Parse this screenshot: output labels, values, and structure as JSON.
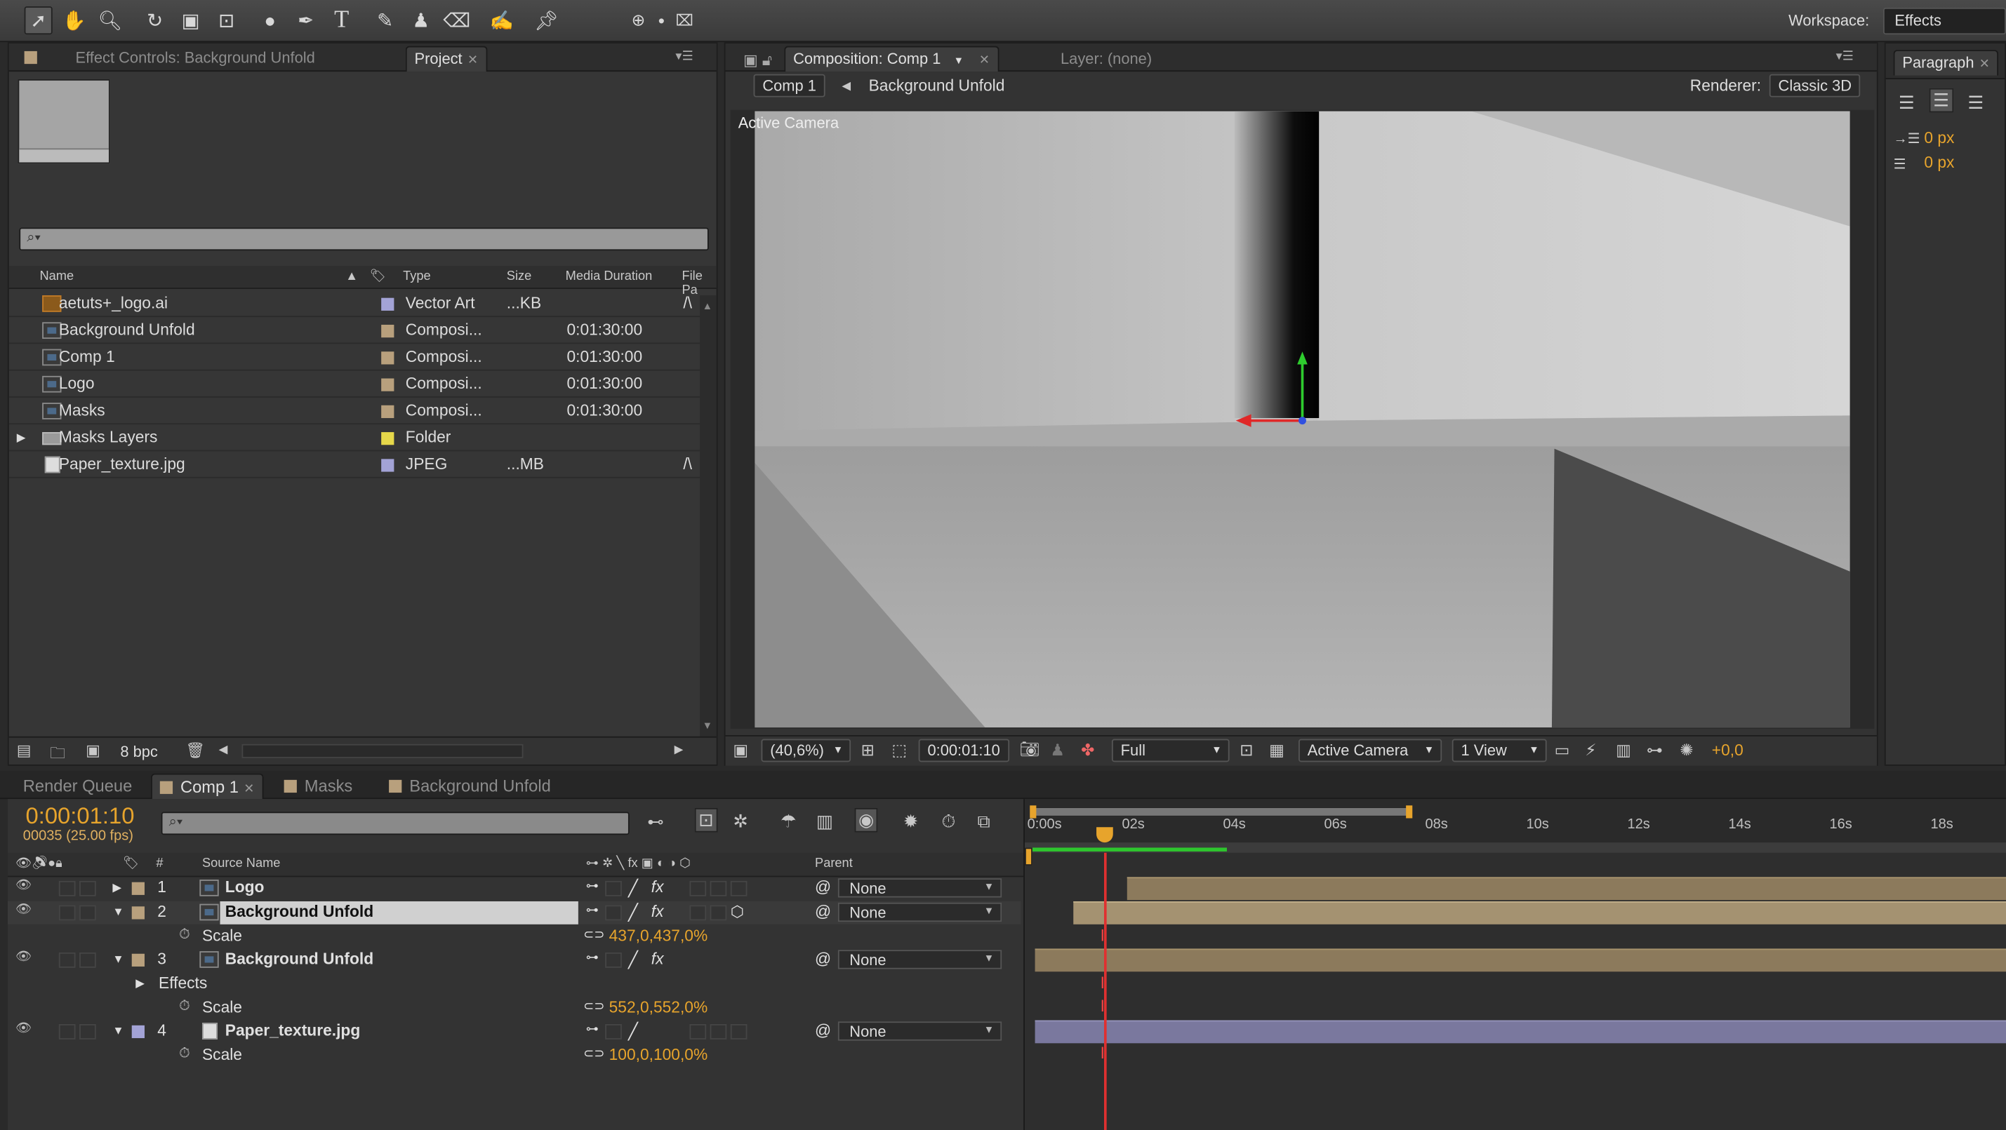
{
  "workspace": {
    "label": "Workspace:",
    "value": "Effects"
  },
  "tools": [
    "selection-tool",
    "hand-tool",
    "zoom-tool",
    "rotation-tool",
    "camera-tool",
    "pan-behind-tool",
    "shape-tool",
    "pen-tool",
    "type-tool",
    "brush-tool",
    "clone-stamp-tool",
    "eraser-tool",
    "roto-brush-tool",
    "puppet-pin-tool"
  ],
  "left_panel": {
    "tabs": [
      {
        "label": "Effect Controls: Background Unfold"
      },
      {
        "label": "Project"
      }
    ],
    "search_placeholder": "",
    "columns": [
      "Name",
      "Type",
      "Size",
      "Media Duration",
      "File Pa"
    ],
    "items": [
      {
        "name": "aetuts+_logo.ai",
        "icon": "illustrator-file-icon",
        "label_color": "#a3a3d6",
        "type": "Vector Art",
        "size": "...KB",
        "duration": "",
        "path": "/\\"
      },
      {
        "name": "Background Unfold",
        "icon": "composition-icon",
        "label_color": "#b8a07d",
        "type": "Composi...",
        "size": "",
        "duration": "0:01:30:00",
        "path": ""
      },
      {
        "name": "Comp 1",
        "icon": "composition-icon",
        "label_color": "#b8a07d",
        "type": "Composi...",
        "size": "",
        "duration": "0:01:30:00",
        "path": ""
      },
      {
        "name": "Logo",
        "icon": "composition-icon",
        "label_color": "#b8a07d",
        "type": "Composi...",
        "size": "",
        "duration": "0:01:30:00",
        "path": ""
      },
      {
        "name": "Masks",
        "icon": "composition-icon",
        "label_color": "#b8a07d",
        "type": "Composi...",
        "size": "",
        "duration": "0:01:30:00",
        "path": ""
      },
      {
        "name": "Masks Layers",
        "icon": "folder-icon",
        "label_color": "#e6d84a",
        "type": "Folder",
        "size": "",
        "duration": "",
        "path": ""
      },
      {
        "name": "Paper_texture.jpg",
        "icon": "image-file-icon",
        "label_color": "#a3a3d6",
        "type": "JPEG",
        "size": "...MB",
        "duration": "",
        "path": "/\\"
      }
    ],
    "bpc": "8 bpc"
  },
  "comp_panel": {
    "tabs": [
      {
        "label": "Composition: Comp 1"
      },
      {
        "label": "Layer: (none)"
      }
    ],
    "breadcrumb": {
      "current": "Comp 1",
      "parent": "Background Unfold"
    },
    "renderer_label": "Renderer:",
    "renderer_value": "Classic 3D",
    "view_label": "Active Camera",
    "footer": {
      "zoom": "(40,6%)",
      "timecode": "0:00:01:10",
      "resolution": "Full",
      "camera": "Active Camera",
      "views": "1 View",
      "exposure": "+0,0"
    }
  },
  "paragraph_panel": {
    "tab": "Paragraph",
    "indent1": "0 px",
    "indent2": "0 px"
  },
  "timeline": {
    "tabs": [
      {
        "label": "Render Queue"
      },
      {
        "label": "Comp 1"
      },
      {
        "label": "Masks"
      },
      {
        "label": "Background Unfold"
      }
    ],
    "timecode": "0:00:01:10",
    "frames": "00035 (25.00 fps)",
    "col_source": "Source Name",
    "col_parent": "Parent",
    "col_num": "#",
    "ruler": [
      "0:00s",
      "02s",
      "04s",
      "06s",
      "08s",
      "10s",
      "12s",
      "14s",
      "16s",
      "18s"
    ],
    "rows": [
      {
        "kind": "layer",
        "num": "1",
        "name": "Logo",
        "label_color": "#b8a07d",
        "parent": "None",
        "expanded": false,
        "selected": false
      },
      {
        "kind": "layer",
        "num": "2",
        "name": "Background Unfold",
        "label_color": "#b8a07d",
        "parent": "None",
        "expanded": true,
        "selected": true
      },
      {
        "kind": "prop",
        "name": "Scale",
        "value": "437,0,437,0%"
      },
      {
        "kind": "layer",
        "num": "3",
        "name": "Background Unfold",
        "label_color": "#b8a07d",
        "parent": "None",
        "expanded": true,
        "selected": false
      },
      {
        "kind": "group",
        "name": "Effects"
      },
      {
        "kind": "prop",
        "name": "Scale",
        "value": "552,0,552,0%"
      },
      {
        "kind": "layer",
        "num": "4",
        "name": "Paper_texture.jpg",
        "label_color": "#a3a3d6",
        "parent": "None",
        "expanded": true,
        "selected": false
      },
      {
        "kind": "prop",
        "name": "Scale",
        "value": "100,0,100,0%"
      }
    ]
  },
  "colors": {
    "accent_orange": "#e7a42c",
    "playhead": "#e03030",
    "layer_bar_tan": "#8c7a5c",
    "layer_bar_purple": "#7a789e"
  }
}
